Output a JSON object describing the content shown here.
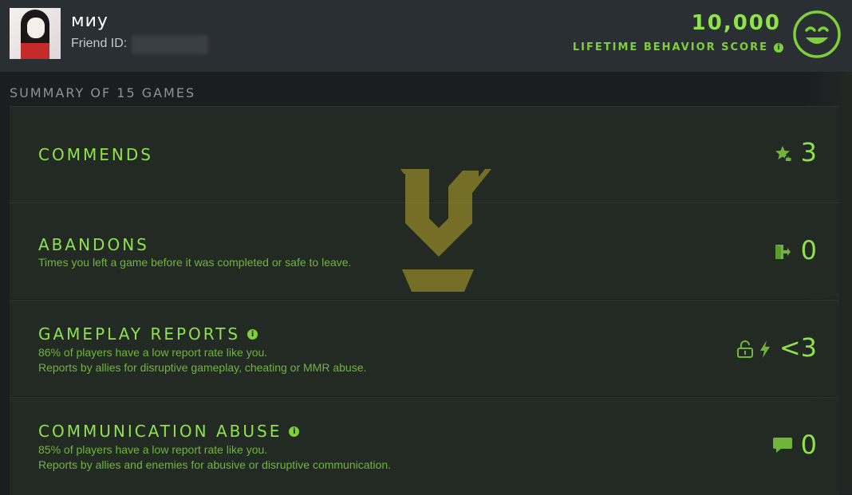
{
  "profile": {
    "username": "миу",
    "friend_id_label": "Friend ID:"
  },
  "behavior": {
    "score": "10,000",
    "label": "LIFETIME BEHAVIOR SCORE",
    "smiley_icon": "smiley-face-icon"
  },
  "summary": {
    "title": "SUMMARY OF 15 GAMES"
  },
  "rows": {
    "commends": {
      "title": "COMMENDS",
      "value": "3",
      "icon": "star-thumbs-up-icon"
    },
    "abandons": {
      "title": "ABANDONS",
      "description": "Times you left a game before it was completed or safe to leave.",
      "value": "0",
      "icon": "exit-door-icon"
    },
    "gameplay_reports": {
      "title": "GAMEPLAY REPORTS",
      "line1": "86% of players have a low report rate like you.",
      "line2": "Reports by allies for disruptive gameplay, cheating or MMR abuse.",
      "value": "<3",
      "icons": [
        "unlocked-padlock-icon",
        "lightning-icon"
      ]
    },
    "communication_abuse": {
      "title": "COMMUNICATION ABUSE",
      "line1": "85% of players have a low report rate like you.",
      "line2": "Reports by allies and enemies for abusive or disruptive communication.",
      "value": "0",
      "icon": "chat-bubble-icon"
    }
  },
  "colors": {
    "accent": "#8ee34a",
    "text_dim": "#6fb53a",
    "header_bg": "#2a2f33",
    "panel_bg": "#232a23"
  }
}
